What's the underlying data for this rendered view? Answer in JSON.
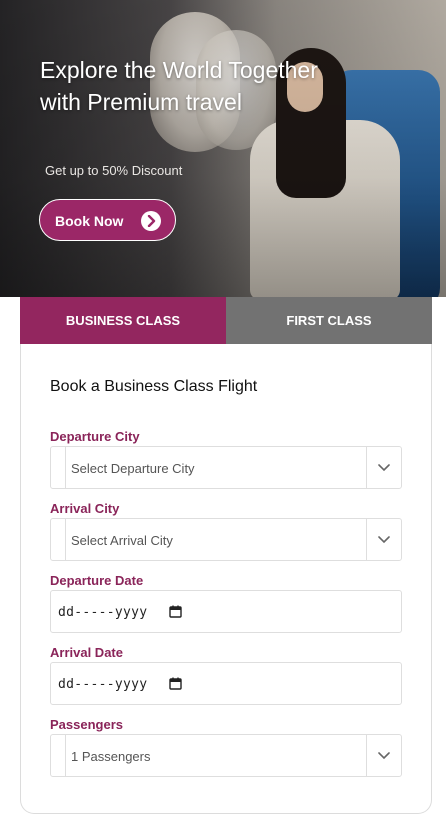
{
  "hero": {
    "title": "Explore the World Together with Premium travel",
    "subtitle": "Get up to 50% Discount",
    "cta_label": "Book Now",
    "cta_icon": "chevron-right-icon"
  },
  "tabs": [
    {
      "label": "BUSINESS CLASS",
      "active": true
    },
    {
      "label": "FIRST CLASS",
      "active": false
    }
  ],
  "form": {
    "title": "Book a Business Class Flight",
    "departure_city": {
      "label": "Departure City",
      "placeholder": "Select Departure City"
    },
    "arrival_city": {
      "label": "Arrival City",
      "placeholder": "Select Arrival City"
    },
    "departure_date": {
      "label": "Departure Date",
      "placeholder": "dd-----yyyy"
    },
    "arrival_date": {
      "label": "Arrival Date",
      "placeholder": "dd-----yyyy"
    },
    "passengers": {
      "label": "Passengers",
      "value": "1 Passengers"
    }
  },
  "colors": {
    "accent": "#93265f",
    "label": "#8a2459",
    "tab_inactive": "#727272"
  }
}
